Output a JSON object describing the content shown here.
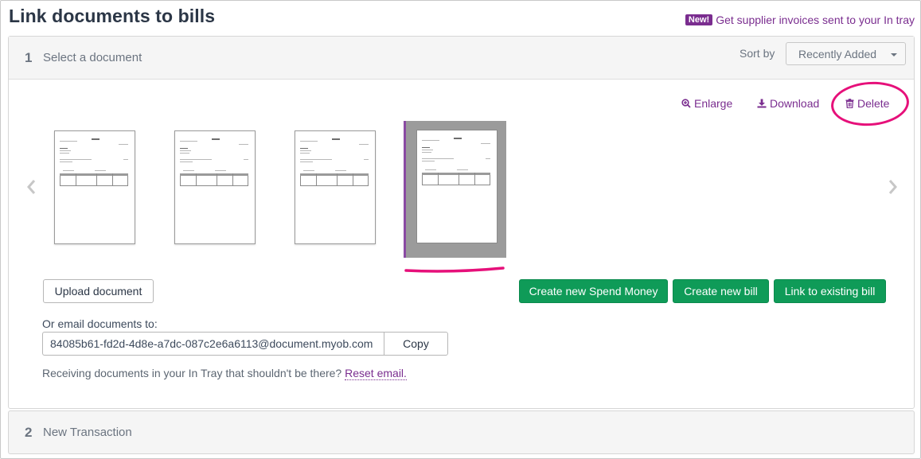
{
  "page": {
    "title": "Link documents to bills"
  },
  "promo": {
    "badge": "New!",
    "link": "Get supplier invoices sent to your In tray"
  },
  "step1": {
    "number": "1",
    "label": "Select a document",
    "sort_label": "Sort by",
    "sort_value": "Recently Added"
  },
  "doc_actions": {
    "enlarge": "Enlarge",
    "download": "Download",
    "delete": "Delete"
  },
  "thumbnails": {
    "count": 4,
    "selected_index": 3
  },
  "buttons": {
    "upload": "Upload document",
    "create_spend_money": "Create new Spend Money",
    "create_bill": "Create new bill",
    "link_existing": "Link to existing bill"
  },
  "email": {
    "label": "Or email documents to:",
    "address": "84085b61-fd2d-4d8e-a7dc-087c2e6a6113@document.myob.com",
    "copy": "Copy"
  },
  "receiving": {
    "text": "Receiving documents in your In Tray that shouldn't be there?",
    "reset": "Reset email."
  },
  "step2": {
    "number": "2",
    "label": "New Transaction"
  },
  "colors": {
    "accent_purple": "#7a2d8f",
    "green": "#0f9b58",
    "annotation_pink": "#e6107a"
  },
  "icons": {
    "enlarge": "zoom-in-icon",
    "download": "download-icon",
    "delete": "trash-icon",
    "prev": "chevron-left-icon",
    "next": "chevron-right-icon",
    "sort": "caret-down-icon"
  }
}
